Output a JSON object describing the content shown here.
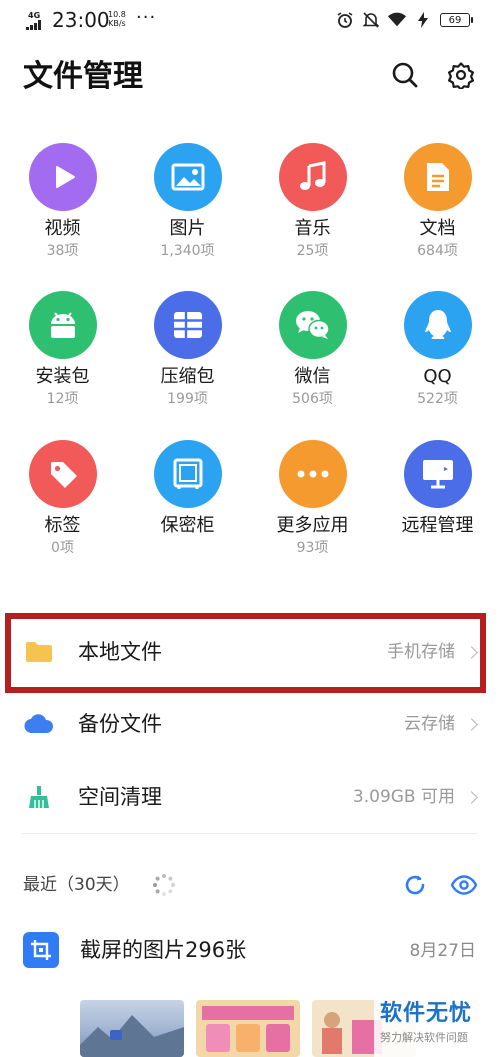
{
  "status_bar": {
    "network": "4G",
    "time": "23:00",
    "speed_value": "10.8",
    "speed_unit": "KB/s",
    "more": "···",
    "battery": "69"
  },
  "header": {
    "title": "文件管理",
    "search_icon": "search-icon",
    "settings_icon": "gear-icon"
  },
  "categories": [
    {
      "label": "视频",
      "count": "38项",
      "color": "#a36cf0",
      "icon": "play-icon"
    },
    {
      "label": "图片",
      "count": "1,340项",
      "color": "#2ba3f0",
      "icon": "image-icon"
    },
    {
      "label": "音乐",
      "count": "25项",
      "color": "#f25a5a",
      "icon": "music-note-icon"
    },
    {
      "label": "文档",
      "count": "684项",
      "color": "#f59a2e",
      "icon": "document-icon"
    },
    {
      "label": "安装包",
      "count": "12项",
      "color": "#2fbf71",
      "icon": "android-icon"
    },
    {
      "label": "压缩包",
      "count": "199项",
      "color": "#4b6de8",
      "icon": "archive-icon"
    },
    {
      "label": "微信",
      "count": "506项",
      "color": "#2fbf71",
      "icon": "wechat-icon"
    },
    {
      "label": "QQ",
      "count": "522项",
      "color": "#2ba3f0",
      "icon": "qq-icon"
    },
    {
      "label": "标签",
      "count": "0项",
      "color": "#f25a5a",
      "icon": "tag-icon"
    },
    {
      "label": "保密柜",
      "count": "",
      "color": "#2ba3f0",
      "icon": "safe-icon"
    },
    {
      "label": "更多应用",
      "count": "93项",
      "color": "#f59a2e",
      "icon": "more-dots-icon"
    },
    {
      "label": "远程管理",
      "count": "",
      "color": "#4b6de8",
      "icon": "monitor-icon"
    }
  ],
  "list": [
    {
      "label": "本地文件",
      "right": "手机存储",
      "icon": "folder-icon",
      "color": "#f5c44e"
    },
    {
      "label": "备份文件",
      "right": "云存储",
      "icon": "cloud-icon",
      "color": "#3d7ff0"
    },
    {
      "label": "空间清理",
      "right": "3.09GB 可用",
      "icon": "broom-icon",
      "color": "#2fbf9a"
    }
  ],
  "recent": {
    "label": "最近（30天）",
    "item_title": "截屏的图片296张",
    "item_date": "8月27日"
  },
  "watermark": {
    "title": "软件无忧",
    "subtitle": "努力解决软件问题"
  },
  "highlight_color": "#b51f1f"
}
